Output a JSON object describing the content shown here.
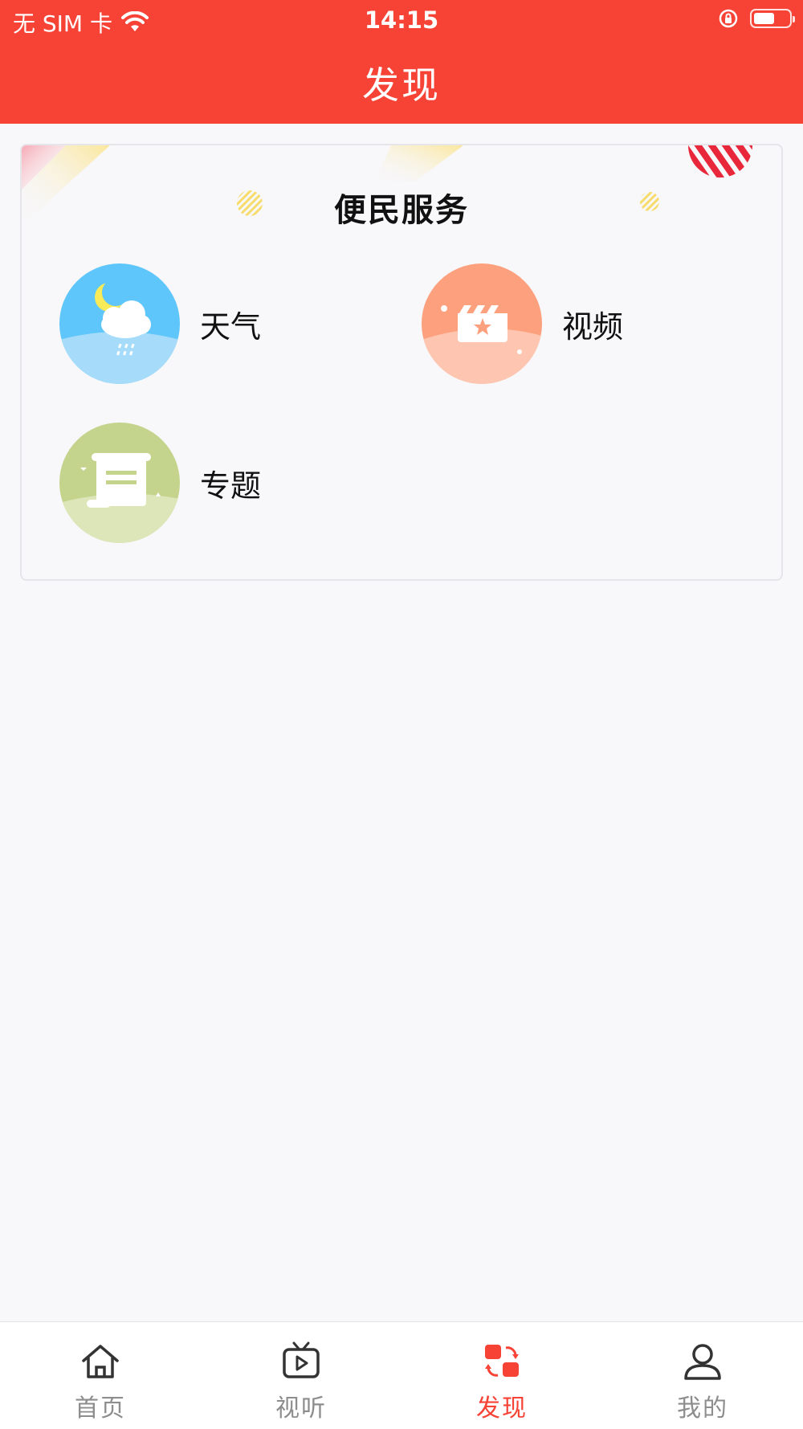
{
  "status_bar": {
    "carrier": "无 SIM 卡",
    "time": "14:15",
    "battery_level": 0.6
  },
  "header": {
    "title": "发现"
  },
  "card": {
    "title": "便民服务",
    "items": [
      {
        "label": "天气",
        "icon": "weather-icon"
      },
      {
        "label": "视频",
        "icon": "video-icon"
      },
      {
        "label": "专题",
        "icon": "topic-icon"
      }
    ]
  },
  "tabbar": {
    "active_color": "#f74236",
    "items": [
      {
        "label": "首页",
        "icon": "home-icon"
      },
      {
        "label": "视听",
        "icon": "tv-icon"
      },
      {
        "label": "发现",
        "icon": "discover-icon",
        "active": true
      },
      {
        "label": "我的",
        "icon": "user-icon"
      }
    ]
  }
}
